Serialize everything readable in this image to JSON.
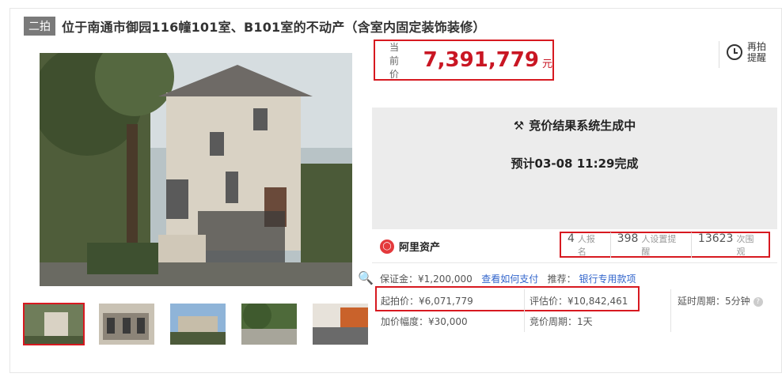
{
  "header": {
    "tag": "二拍",
    "title": "位于南通市御园116幢101室、B101室的不动产（含室内固定装饰装修）"
  },
  "price": {
    "label": "当前价",
    "value": "7,391,779",
    "unit": "元"
  },
  "remind": {
    "label": "再拍提醒"
  },
  "status": {
    "title": "竞价结果系统生成中",
    "subtitle": "预计03-08 11:29完成"
  },
  "brand": {
    "name": "阿里资产"
  },
  "stats": [
    {
      "value": "4",
      "label": "人报名"
    },
    {
      "value": "398",
      "label": "人设置提醒"
    },
    {
      "value": "13623",
      "label": "次围观"
    }
  ],
  "deposit": {
    "label": "保证金：",
    "value": "¥1,200,000",
    "link": "查看如何支付"
  },
  "recommend": {
    "label": "推荐：",
    "link": "银行专用款项"
  },
  "details": {
    "start_price": {
      "label": "起拍价：",
      "value": "¥6,071,779"
    },
    "appraisal": {
      "label": "评估价：",
      "value": "¥10,842,461"
    },
    "delay": {
      "label": "延时周期：",
      "value": "5分钟"
    },
    "increment": {
      "label": "加价幅度：",
      "value": "¥30,000"
    },
    "cycle": {
      "label": "竞价周期：",
      "value": "1天"
    }
  },
  "colors": {
    "accent": "#c91623",
    "link": "#3366cc",
    "status_bg": "#ececec"
  },
  "icons": [
    "zoom-icon",
    "clock-icon",
    "gavel-icon",
    "ali-logo-icon",
    "help-icon"
  ]
}
